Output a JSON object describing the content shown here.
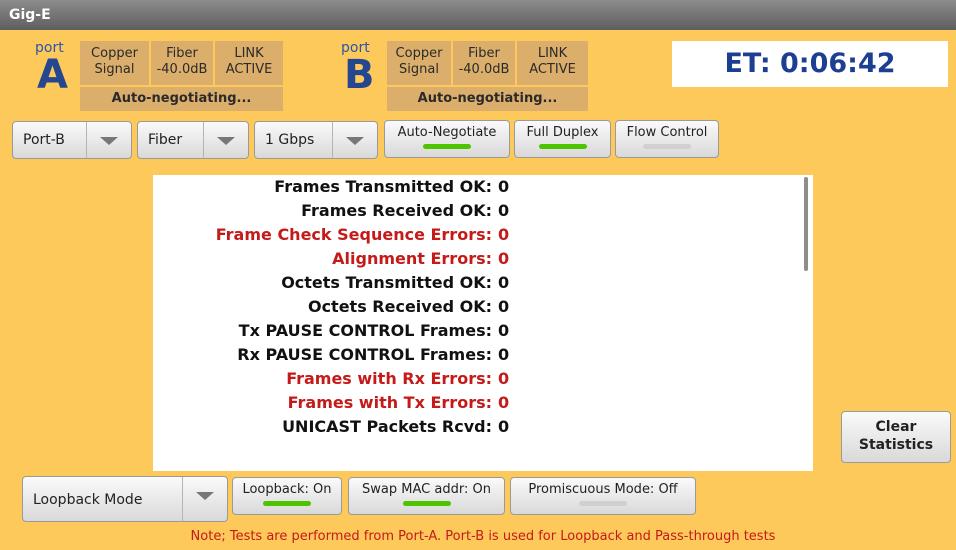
{
  "app": {
    "title": "Gig-E"
  },
  "portA": {
    "word": "port",
    "letter": "A",
    "signal": {
      "line1": "Copper",
      "line2": "Signal"
    },
    "fiber": {
      "line1": "Fiber",
      "line2": "-40.0dB"
    },
    "link": {
      "line1": "LINK",
      "line2": "ACTIVE"
    },
    "status": "Auto-negotiating..."
  },
  "portB": {
    "word": "port",
    "letter": "B",
    "signal": {
      "line1": "Copper",
      "line2": "Signal"
    },
    "fiber": {
      "line1": "Fiber",
      "line2": "-40.0dB"
    },
    "link": {
      "line1": "LINK",
      "line2": "ACTIVE"
    },
    "status": "Auto-negotiating..."
  },
  "timer": {
    "text": "ET: 0:06:42"
  },
  "controls": {
    "port_select": "Port-B",
    "media_select": "Fiber",
    "speed_select": "1 Gbps",
    "auto_negotiate": {
      "label": "Auto-Negotiate",
      "on": true
    },
    "full_duplex": {
      "label": "Full Duplex",
      "on": true
    },
    "flow_control": {
      "label": "Flow Control",
      "on": false
    }
  },
  "stats": [
    {
      "label": "Frames Transmitted OK:",
      "value": "0",
      "error": false
    },
    {
      "label": "Frames Received OK:",
      "value": "0",
      "error": false
    },
    {
      "label": "Frame Check Sequence Errors:",
      "value": "0",
      "error": true
    },
    {
      "label": "Alignment Errors:",
      "value": "0",
      "error": true
    },
    {
      "label": "Octets Transmitted OK:",
      "value": "0",
      "error": false
    },
    {
      "label": "Octets Received OK:",
      "value": "0",
      "error": false
    },
    {
      "label": "Tx PAUSE CONTROL Frames:",
      "value": "0",
      "error": false
    },
    {
      "label": "Rx PAUSE CONTROL Frames:",
      "value": "0",
      "error": false
    },
    {
      "label": "Frames with Rx Errors:",
      "value": "0",
      "error": true
    },
    {
      "label": "Frames with Tx Errors:",
      "value": "0",
      "error": true
    },
    {
      "label": "UNICAST Packets Rcvd:",
      "value": "0",
      "error": false
    }
  ],
  "clear_button": {
    "line1": "Clear",
    "line2": "Statistics"
  },
  "bottom": {
    "mode_select": "Loopback Mode",
    "loopback": {
      "label": "Loopback: On",
      "on": true
    },
    "swap_mac": {
      "label": "Swap MAC addr: On",
      "on": true
    },
    "promiscuous": {
      "label": "Promiscuous Mode: Off",
      "on": false
    }
  },
  "note": "Note; Tests are performed from Port-A.  Port-B is used for Loopback and Pass-through tests",
  "colors": {
    "background": "#fdc95a",
    "error_text": "#c41a1a",
    "indicator_on": "#4ec400",
    "port_box": "#dcae6b"
  }
}
